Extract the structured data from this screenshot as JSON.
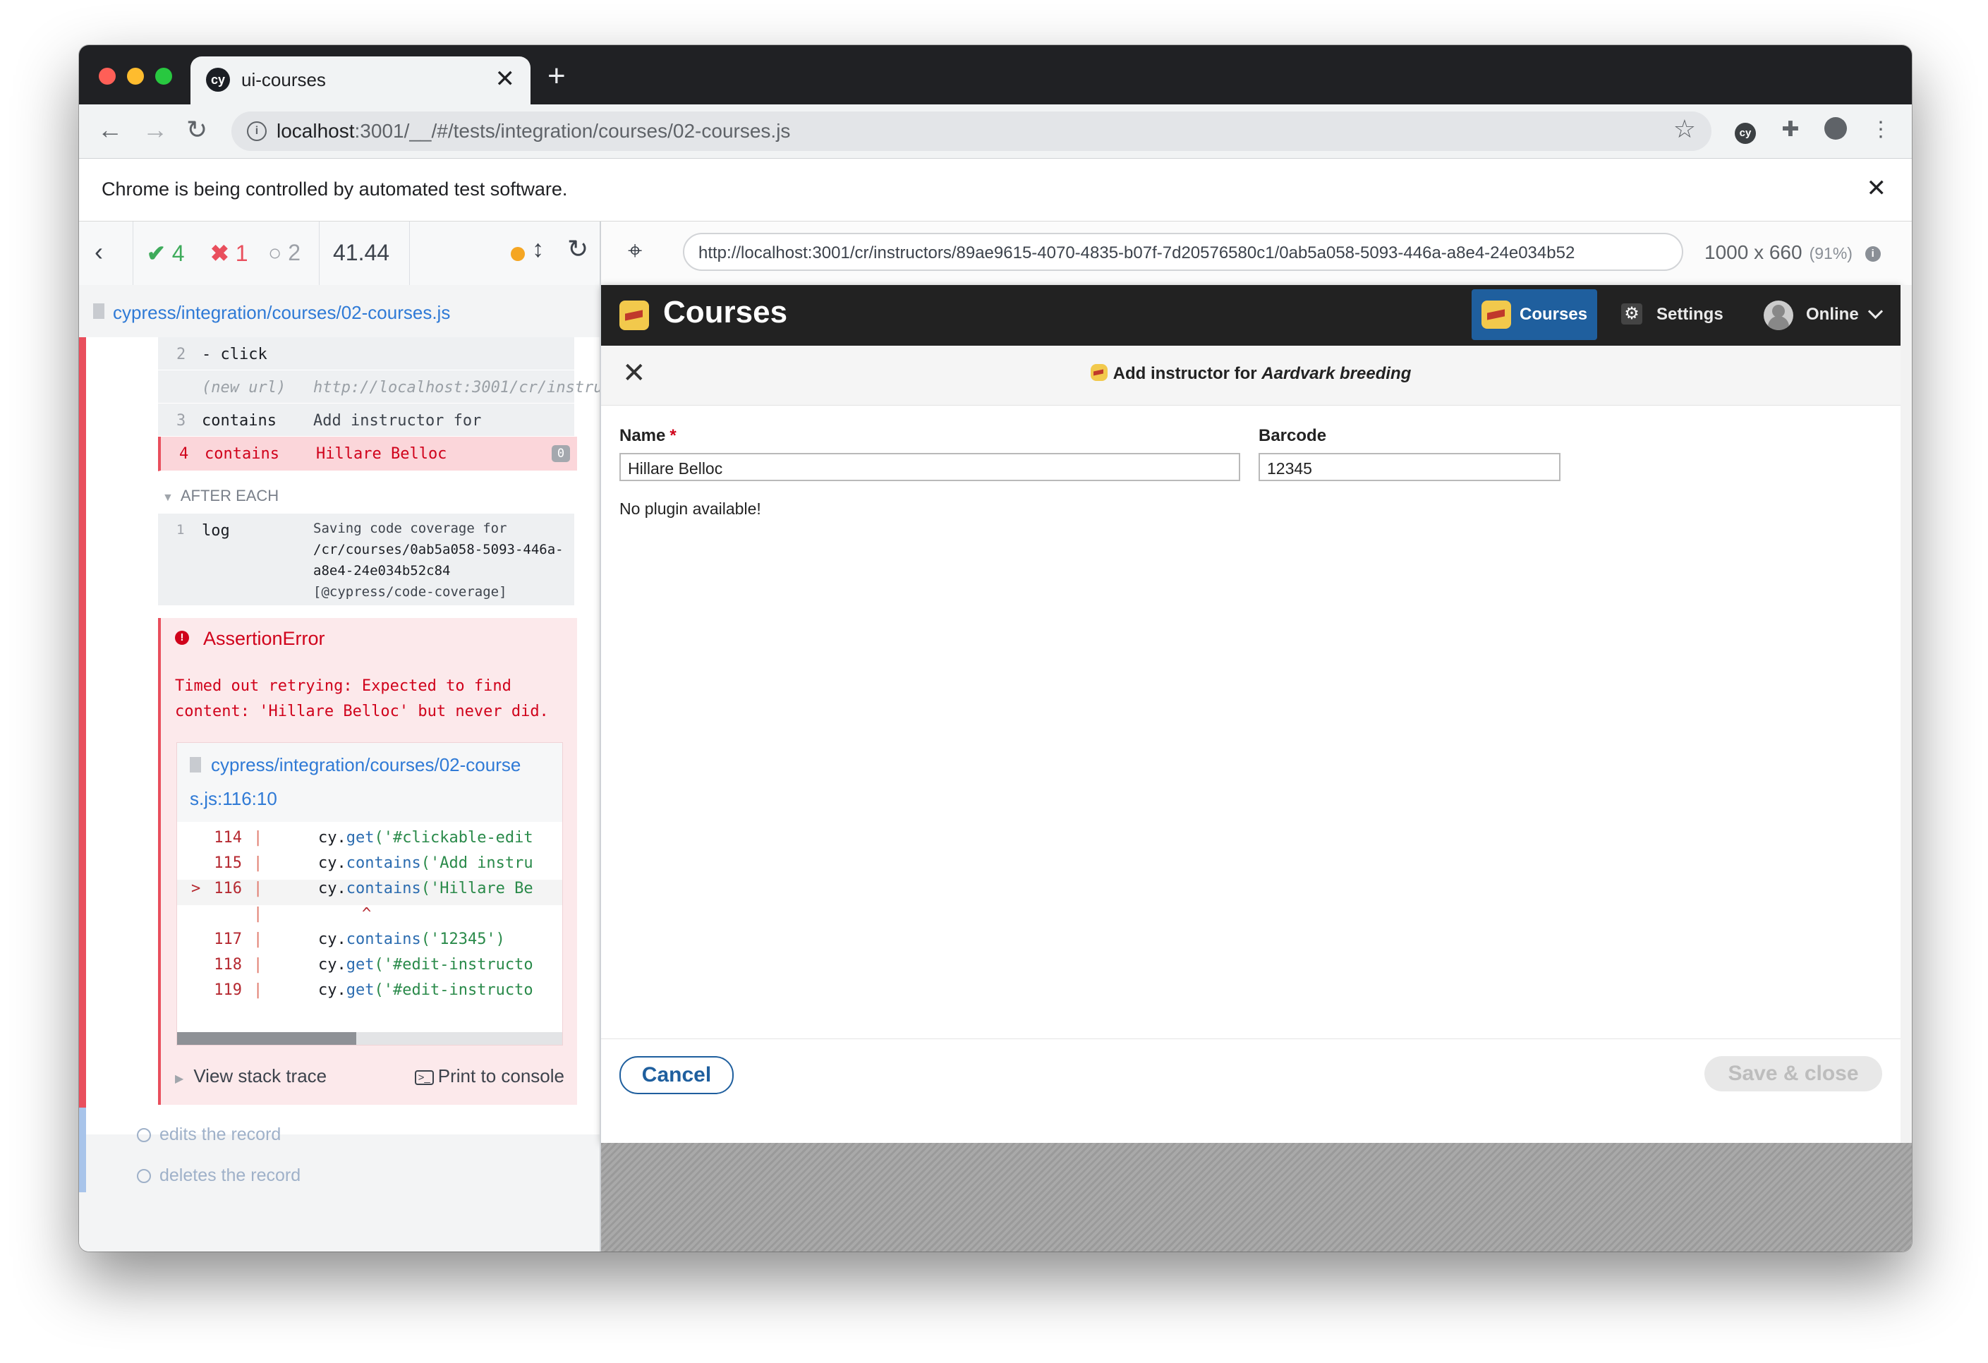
{
  "browser": {
    "tab_title": "ui-courses",
    "tab_icon": "cy",
    "tab_close": "✕",
    "new_tab": "+",
    "url_host": "localhost",
    "url_rest": ":3001/__/#/tests/integration/courses/02-courses.js",
    "ext_icon": "cy",
    "infobar_text": "Chrome is being controlled by automated test software.",
    "infobar_close": "✕"
  },
  "reporter": {
    "passed": "4",
    "failed": "1",
    "pending": "2",
    "duration": "41.44",
    "spec_path": "cypress/integration/courses/02-courses.js",
    "commands": [
      {
        "num": "2",
        "name": "- click",
        "message": ""
      },
      {
        "num": "",
        "name": "(new url)",
        "message": "http://localhost:3001/cr/instru…"
      },
      {
        "num": "3",
        "name": "contains",
        "message": "Add instructor for"
      },
      {
        "num": "4",
        "name": "contains",
        "message": "Hillare Belloc",
        "badge": "0"
      }
    ],
    "after_each_label": "AFTER EACH",
    "log": {
      "num": "1",
      "name": "log",
      "lines": [
        "Saving code coverage for",
        "/cr/courses/0ab5a058-5093-446a-",
        "a8e4-24e034b52c84",
        "[@cypress/code-coverage]"
      ]
    },
    "error": {
      "title": "AssertionError",
      "message_lines": [
        "Timed out retrying: Expected to find",
        "content: 'Hillare Belloc' but never did."
      ],
      "file_line1": "cypress/integration/courses/02-course",
      "file_line2": "s.js:116:10",
      "code": [
        {
          "ln": "114",
          "pre": "cy.",
          "fn": "get",
          "arg": "('#clickable-edit"
        },
        {
          "ln": "115",
          "pre": "cy.",
          "fn": "contains",
          "arg": "('Add instru"
        },
        {
          "ln": "116",
          "pre": "cy.",
          "fn": "contains",
          "arg": "('Hillare Be",
          "marker": ">"
        },
        {
          "ln": "",
          "caret": "^"
        },
        {
          "ln": "117",
          "pre": "cy.",
          "fn": "contains",
          "arg": "('12345')"
        },
        {
          "ln": "118",
          "pre": "cy.",
          "fn": "get",
          "arg": "('#edit-instructo"
        },
        {
          "ln": "119",
          "pre": "cy.",
          "fn": "get",
          "arg": "('#edit-instructo"
        }
      ],
      "view_stack": "View stack trace",
      "print_console": "Print to console"
    },
    "pending_tests": [
      "edits the record",
      "deletes the record"
    ]
  },
  "aut": {
    "url": "http://localhost:3001/cr/instructors/89ae9615-4070-4835-b07f-7d20576580c1/0ab5a058-5093-446a-a8e4-24e034b52",
    "size": "1000 x 660",
    "scale": "(91%)"
  },
  "app": {
    "title": "Courses",
    "nav_courses": "Courses",
    "nav_settings": "Settings",
    "nav_online": "Online",
    "dialog_title_prefix": "Add instructor for ",
    "dialog_title_course": "Aardvark breeding",
    "name_label": "Name",
    "required_mark": "*",
    "name_value": "Hillare Belloc",
    "barcode_label": "Barcode",
    "barcode_value": "12345",
    "no_plugin": "No plugin available!",
    "cancel": "Cancel",
    "save_close": "Save & close"
  },
  "colors": {
    "passed": "#3eab5b",
    "failed": "#e94f5d",
    "pending_dot": "#f5a623",
    "link": "#2f7ad6",
    "app_nav": "#222222",
    "app_accent": "#1f5f9e"
  }
}
